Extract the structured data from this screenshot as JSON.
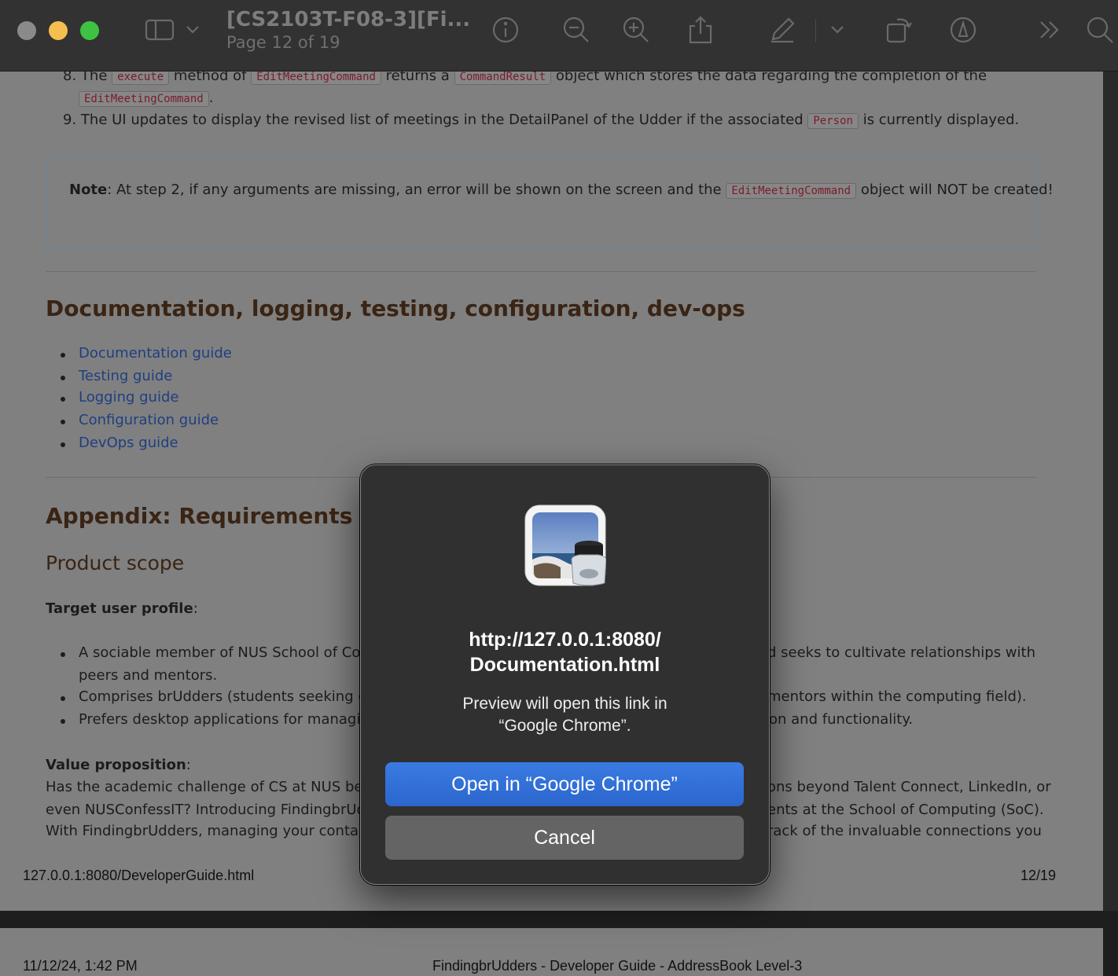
{
  "toolbar": {
    "title": "[CS2103T-F08-3][Fi...",
    "subtitle": "Page 12 of 19"
  },
  "document": {
    "step8": {
      "num": "8.",
      "t1": "The",
      "code1": "execute",
      "t2": "method of",
      "code2": "EditMeetingCommand",
      "t3": "returns a",
      "code3": "CommandResult",
      "t4": "object which stores the data regarding the completion of the",
      "code4": "EditMeetingCommand",
      "t5": "."
    },
    "step9": {
      "num": "9.",
      "t1": "The UI updates to display the revised list of meetings in the DetailPanel of the Udder if the associated",
      "code1": "Person",
      "t2": "is currently displayed."
    },
    "note": {
      "label": "Note",
      "t1": ": At step 2, if any arguments are missing, an error will be shown on the screen and the",
      "code": "EditMeetingCommand",
      "t2": "object will NOT be created!"
    },
    "heading_docs": "Documentation, logging, testing, configuration, dev-ops",
    "links": [
      "Documentation guide",
      "Testing guide",
      "Logging guide",
      "Configuration guide",
      "DevOps guide"
    ],
    "heading_appendix": "Appendix: Requirements",
    "heading_scope": "Product scope",
    "target_label": "Target user profile",
    "target_colon": ":",
    "bullets": {
      "b1_left": "A sociable member of NUS School of Comp",
      "b1_right": "d seeks to cultivate relationships with",
      "b1_line2": "peers and mentors.",
      "b2_left": "Comprises brUdders (students seeking guid",
      "b2_right": "mentors within the computing field).",
      "b3_left": "Prefers desktop applications for managing",
      "b3_right": "on and functionality."
    },
    "value_label": "Value proposition",
    "value_colon": ":",
    "value": {
      "l1_left": "Has the academic challenge of CS at NUS becom",
      "l1_right": "ons beyond Talent Connect, LinkedIn, or",
      "l2_left": "even NUSConfessIT? Introducing FindingbrUdde",
      "l2_right": "ents at the School of Computing (SoC).",
      "l3_left": "With FindingbrUdders, managing your contacts a",
      "l3_right": "rack of the invaluable connections you"
    },
    "footer_url": "127.0.0.1:8080/DeveloperGuide.html",
    "footer_page": "12/19",
    "next_date": "11/12/24, 1:42 PM",
    "next_title": "FindingbrUdders - Developer Guide - AddressBook Level-3"
  },
  "dialog": {
    "title_line1": "http://127.0.0.1:8080/",
    "title_line2": "Documentation.html",
    "message_line1": "Preview will open this link in",
    "message_line2": "“Google Chrome”.",
    "open_button": "Open in “Google Chrome”",
    "cancel_button": "Cancel"
  },
  "colors": {
    "close": "#8a8a8a",
    "minimize": "#f5bf4f",
    "zoom": "#3ec244",
    "primary_button": "#2f6fd6"
  },
  "icons": [
    "sidebar-icon",
    "chevron-down-icon",
    "info-icon",
    "zoom-out-icon",
    "zoom-in-icon",
    "share-icon",
    "markup-pen-icon",
    "rotate-icon",
    "highlight-icon",
    "more-icon",
    "search-icon",
    "preview-app-icon"
  ]
}
